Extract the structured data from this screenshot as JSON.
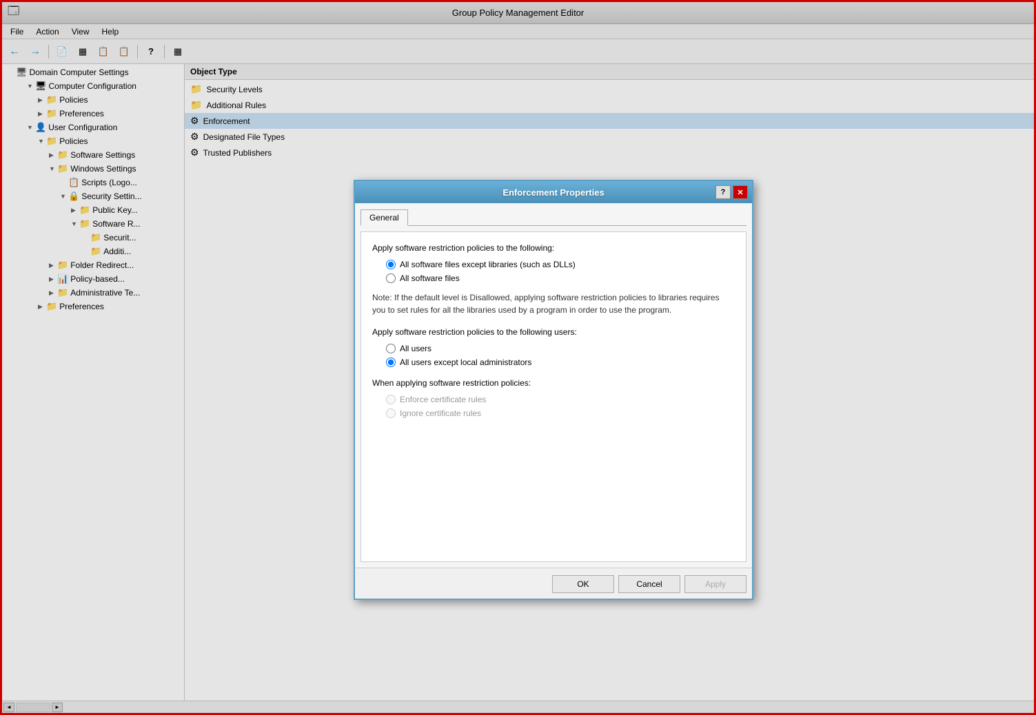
{
  "window": {
    "title": "Group Policy Management Editor",
    "title_icon": "🗔"
  },
  "menu": {
    "items": [
      "File",
      "Action",
      "View",
      "Help"
    ]
  },
  "toolbar": {
    "buttons": [
      {
        "name": "back",
        "icon": "←"
      },
      {
        "name": "forward",
        "icon": "→"
      },
      {
        "name": "up",
        "icon": "📄"
      },
      {
        "name": "show-hide",
        "icon": "▦"
      },
      {
        "name": "copy",
        "icon": "📋"
      },
      {
        "name": "paste",
        "icon": "📋"
      },
      {
        "name": "help",
        "icon": "?"
      },
      {
        "name": "extra",
        "icon": "▦"
      }
    ]
  },
  "tree": {
    "items": [
      {
        "id": "domain",
        "label": "Domain Computer Settings",
        "indent": 0,
        "icon": "🖥",
        "expanded": true,
        "type": "computer"
      },
      {
        "id": "comp-config",
        "label": "Computer Configuration",
        "indent": 1,
        "icon": "🖥",
        "expanded": true,
        "type": "computer"
      },
      {
        "id": "policies1",
        "label": "Policies",
        "indent": 2,
        "icon": "📁",
        "expanded": false,
        "type": "folder"
      },
      {
        "id": "preferences1",
        "label": "Preferences",
        "indent": 2,
        "icon": "📁",
        "expanded": false,
        "type": "folder"
      },
      {
        "id": "user-config",
        "label": "User Configuration",
        "indent": 1,
        "icon": "👤",
        "expanded": true,
        "type": "user"
      },
      {
        "id": "policies2",
        "label": "Policies",
        "indent": 2,
        "icon": "📁",
        "expanded": true,
        "type": "folder"
      },
      {
        "id": "software-settings",
        "label": "Software Settings",
        "indent": 3,
        "icon": "📁",
        "expanded": false,
        "type": "folder"
      },
      {
        "id": "windows-settings",
        "label": "Windows Settings",
        "indent": 3,
        "icon": "📁",
        "expanded": true,
        "type": "folder"
      },
      {
        "id": "scripts",
        "label": "Scripts (Logo...",
        "indent": 4,
        "icon": "📋",
        "expanded": false,
        "type": "script"
      },
      {
        "id": "security-settings",
        "label": "Security Settin...",
        "indent": 4,
        "icon": "🔒",
        "expanded": true,
        "type": "security"
      },
      {
        "id": "public-key",
        "label": "Public Key...",
        "indent": 5,
        "icon": "📁",
        "expanded": false,
        "type": "folder"
      },
      {
        "id": "software-r",
        "label": "Software R...",
        "indent": 5,
        "icon": "📁",
        "expanded": true,
        "type": "folder"
      },
      {
        "id": "security-levels",
        "label": "Securit...",
        "indent": 6,
        "icon": "📁",
        "expanded": false,
        "type": "folder"
      },
      {
        "id": "additional-rules",
        "label": "Additi...",
        "indent": 6,
        "icon": "📁",
        "expanded": false,
        "type": "folder"
      },
      {
        "id": "folder-redirect",
        "label": "Folder Redirect...",
        "indent": 3,
        "icon": "📁",
        "expanded": false,
        "type": "folder"
      },
      {
        "id": "policy-based",
        "label": "Policy-based...",
        "indent": 3,
        "icon": "📊",
        "expanded": false,
        "type": "policy"
      },
      {
        "id": "admin-templates",
        "label": "Administrative Te...",
        "indent": 3,
        "icon": "📁",
        "expanded": false,
        "type": "folder"
      },
      {
        "id": "preferences2",
        "label": "Preferences",
        "indent": 2,
        "icon": "📁",
        "expanded": false,
        "type": "folder"
      }
    ]
  },
  "right_panel": {
    "column_header": "Object Type",
    "items": [
      {
        "id": "security-levels",
        "label": "Security Levels",
        "icon": "📁",
        "selected": false
      },
      {
        "id": "additional-rules",
        "label": "Additional Rules",
        "icon": "📁",
        "selected": false
      },
      {
        "id": "enforcement",
        "label": "Enforcement",
        "icon": "⚙",
        "selected": true
      },
      {
        "id": "designated-file-types",
        "label": "Designated File Types",
        "icon": "⚙",
        "selected": false
      },
      {
        "id": "trusted-publishers",
        "label": "Trusted Publishers",
        "icon": "⚙",
        "selected": false
      }
    ]
  },
  "dialog": {
    "title": "Enforcement Properties",
    "btn_help": "?",
    "btn_close": "✕",
    "tab_general": "General",
    "section1_label": "Apply software restriction policies to the following:",
    "radio1_1": "All software files except libraries (such as DLLs)",
    "radio1_2": "All software files",
    "note": "Note:  If the default level is Disallowed, applying software restriction policies to libraries requires you to set rules for all the libraries used by a program in order to use the program.",
    "section2_label": "Apply software restriction policies to the following users:",
    "radio2_1": "All users",
    "radio2_2": "All users except local administrators",
    "section3_label": "When applying software restriction policies:",
    "radio3_1": "Enforce certificate rules",
    "radio3_2": "Ignore certificate rules",
    "btn_ok": "OK",
    "btn_cancel": "Cancel",
    "btn_apply": "Apply"
  },
  "status": {
    "scroll_left": "◄",
    "scroll_right": "►"
  }
}
